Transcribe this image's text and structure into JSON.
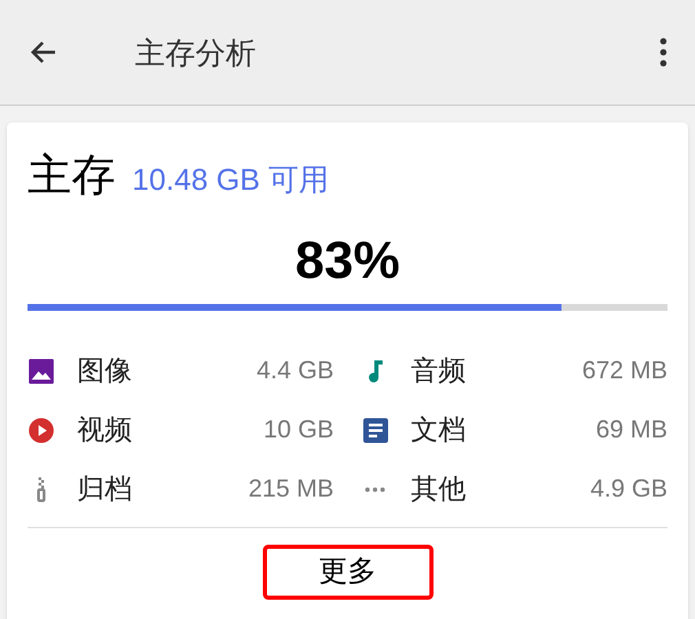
{
  "app_bar": {
    "title": "主存分析"
  },
  "storage": {
    "name": "主存",
    "available": "10.48 GB 可用",
    "percent": "83%",
    "level": 0.835
  },
  "categories": [
    {
      "kind": "image",
      "label": "图像",
      "size": "4.4 GB"
    },
    {
      "kind": "audio",
      "label": "音频",
      "size": "672 MB"
    },
    {
      "kind": "video",
      "label": "视频",
      "size": "10 GB"
    },
    {
      "kind": "document",
      "label": "文档",
      "size": "69 MB"
    },
    {
      "kind": "archive",
      "label": "归档",
      "size": "215 MB"
    },
    {
      "kind": "other",
      "label": "其他",
      "size": "4.9 GB"
    }
  ],
  "more_button": {
    "label": "更多",
    "highlighted": true
  }
}
